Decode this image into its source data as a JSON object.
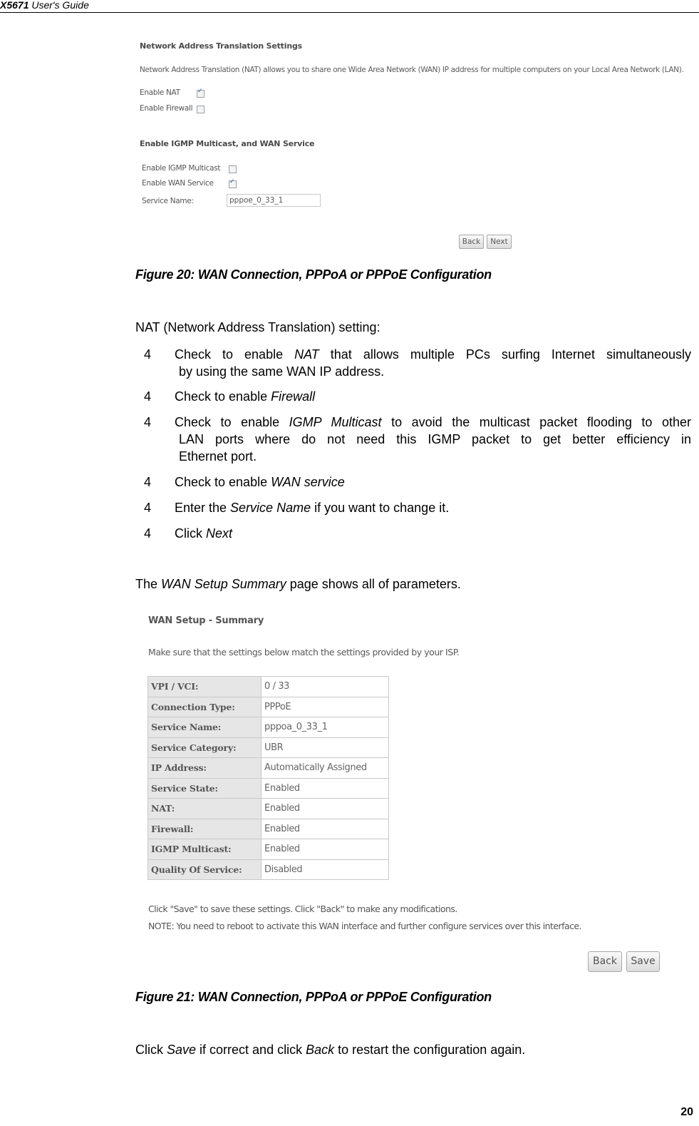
{
  "header": {
    "model": "X5671",
    "title_rest": " User's Guide"
  },
  "figure20": {
    "heading": "Network Address Translation Settings",
    "description": "Network Address Translation (NAT) allows you to share one Wide Area Network (WAN) IP address for multiple computers on your Local Area Network (LAN).",
    "enable_nat_label": "Enable NAT",
    "enable_nat_checked": true,
    "enable_firewall_label": "Enable Firewall",
    "enable_firewall_checked": false,
    "section2_heading": "Enable IGMP  Multicast, and WAN Service",
    "enable_igmp_label": "Enable IGMP Multicast",
    "enable_igmp_checked": false,
    "enable_wan_label": "Enable WAN Service",
    "enable_wan_checked": true,
    "service_name_label": "Service Name:",
    "service_name_value": "pppoe_0_33_1",
    "back_button": "Back",
    "next_button": "Next",
    "caption": "Figure 20: WAN Connection, PPPoA or PPPoE Configuration"
  },
  "instructions": {
    "intro": "NAT (Network Address Translation) setting:",
    "bullet": "4",
    "steps": [
      {
        "pre": "Check to enable ",
        "em": "NAT",
        "post": " that allows multiple PCs surfing Internet simultaneously",
        "cont": "by using the same WAN IP address."
      },
      {
        "pre": "Check to enable ",
        "em": "Firewall",
        "post": ""
      },
      {
        "pre": "Check to enable ",
        "em": "IGMP Multicast",
        "post": " to avoid the multicast packet flooding to other",
        "cont": "LAN ports where do not need this IGMP packet to get better efficiency in",
        "cont2": "Ethernet port."
      },
      {
        "pre": "Check to enable ",
        "em": "WAN service",
        "post": ""
      },
      {
        "pre": "Enter the ",
        "em": "Service Name",
        "post": " if you want to change it."
      },
      {
        "pre": "Click ",
        "em": "Next",
        "post": ""
      }
    ]
  },
  "summary_intro": {
    "pre": "The ",
    "em": "WAN Setup Summary",
    "post": " page shows all of parameters."
  },
  "figure21": {
    "heading": "WAN Setup - Summary",
    "description": "Make sure that the settings below match the settings provided by your ISP.",
    "rows": [
      {
        "key": "VPI / VCI:",
        "value": "0 / 33"
      },
      {
        "key": "Connection Type:",
        "value": "PPPoE"
      },
      {
        "key": "Service Name:",
        "value": "pppoa_0_33_1"
      },
      {
        "key": "Service Category:",
        "value": "UBR"
      },
      {
        "key": "IP Address:",
        "value": "Automatically Assigned"
      },
      {
        "key": "Service State:",
        "value": "Enabled"
      },
      {
        "key": "NAT:",
        "value": "Enabled"
      },
      {
        "key": "Firewall:",
        "value": "Enabled"
      },
      {
        "key": "IGMP  Multicast:",
        "value": "Enabled"
      },
      {
        "key": "Quality Of Service:",
        "value": "Disabled"
      }
    ],
    "note1": "Click  \"Save\" to save these settings. Click \"Back\" to make any modifications.",
    "note2": "NOTE:  You need to reboot to activate this WAN interface and further configure services over this interface.",
    "back_button": "Back",
    "save_button": "Save",
    "caption": "Figure 21: WAN Connection, PPPoA or PPPoE Configuration"
  },
  "closing": {
    "pre": "Click ",
    "em1": "Save",
    "mid": " if correct and click ",
    "em2": "Back",
    "post": " to restart the configuration again."
  },
  "page_number": "20"
}
